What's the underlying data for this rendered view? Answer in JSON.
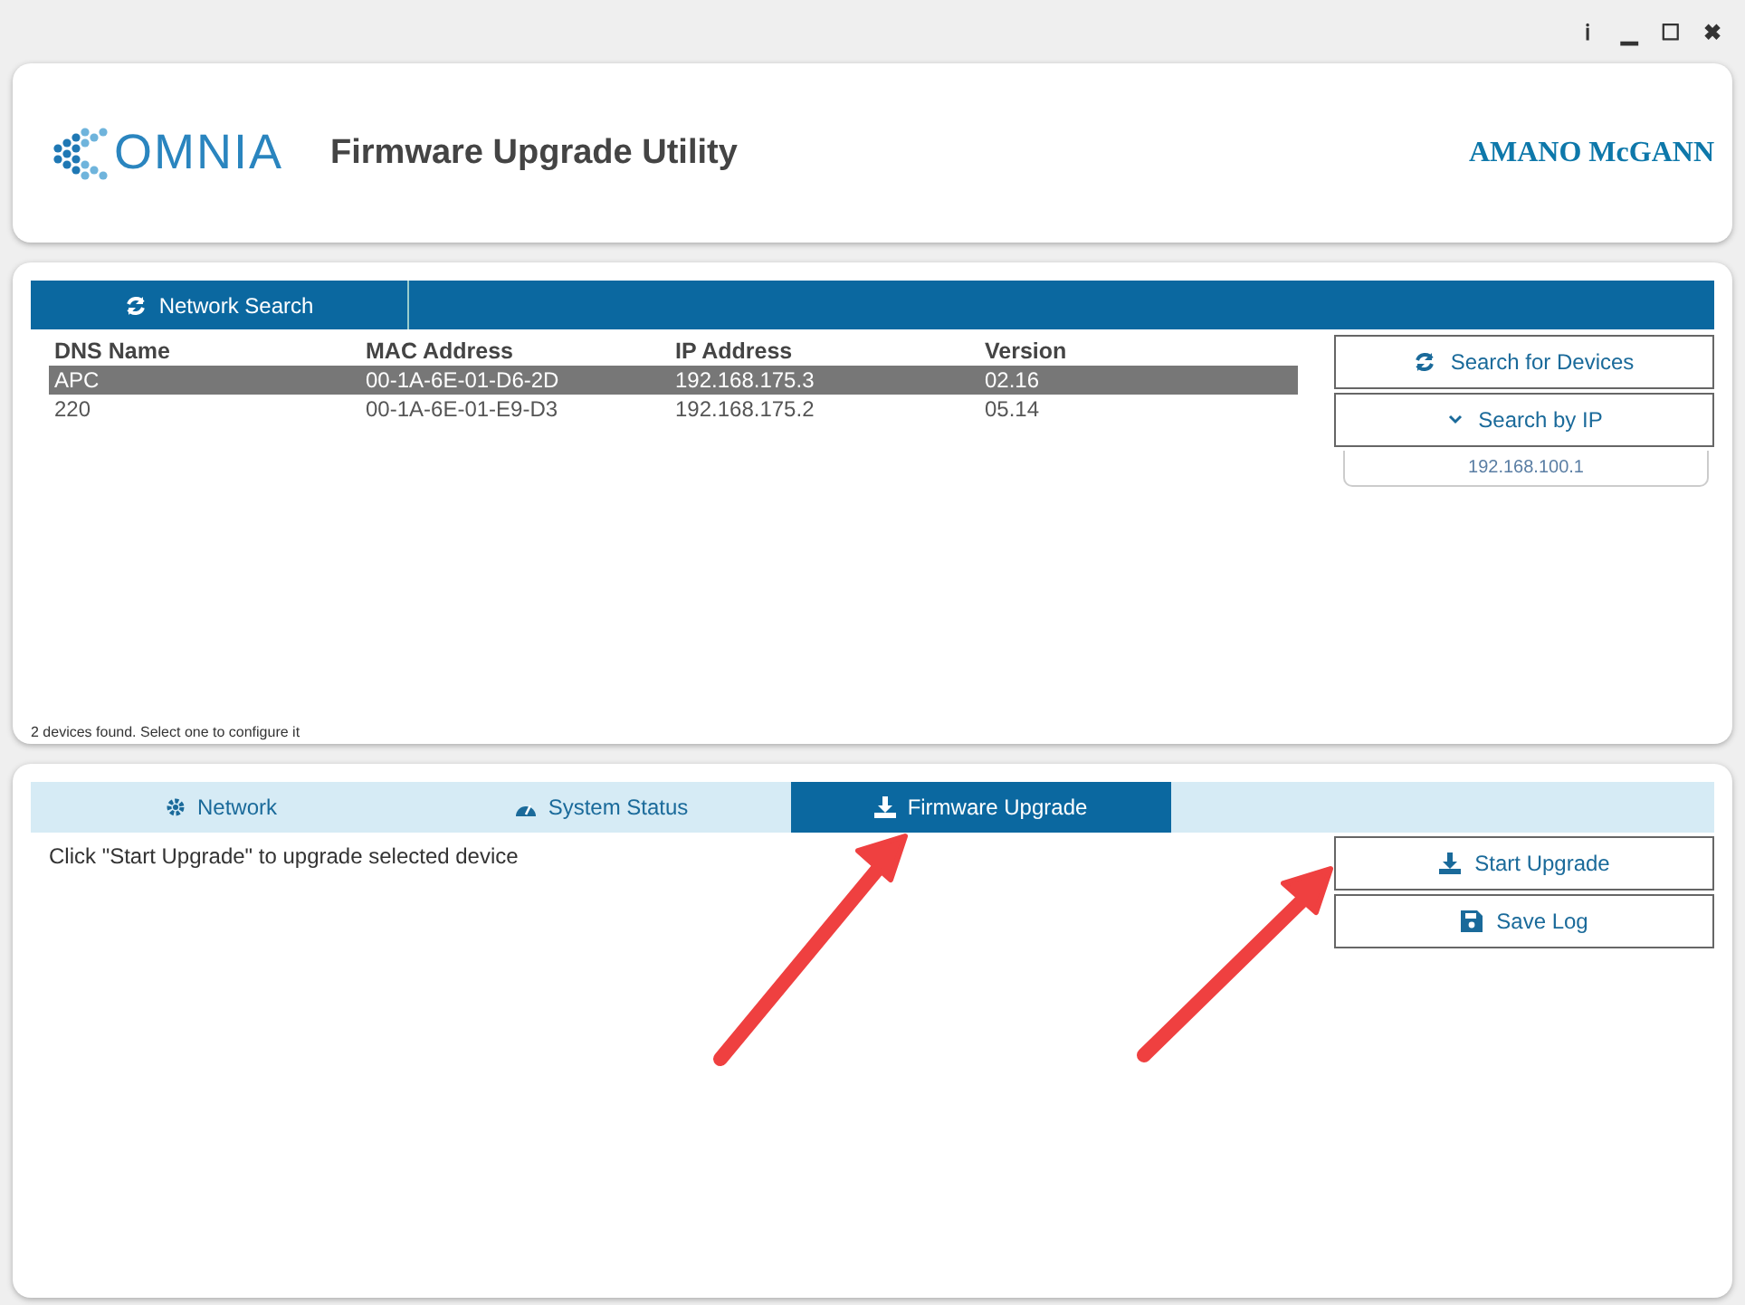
{
  "window_controls": {
    "info": "ℹ",
    "minimize": "▁",
    "maximize": "☐",
    "close": "✖"
  },
  "header": {
    "logo_text": "OMNIA",
    "title": "Firmware Upgrade Utility",
    "brand": "AMANO McGANN"
  },
  "network": {
    "tab": "Network Search",
    "columns": [
      "DNS Name",
      "MAC Address",
      "IP Address",
      "Version"
    ],
    "rows": [
      {
        "cells": [
          "APC",
          "00-1A-6E-01-D6-2D",
          "192.168.175.3",
          "02.16"
        ],
        "selected": true
      },
      {
        "cells": [
          "220",
          "00-1A-6E-01-E9-D3",
          "192.168.175.2",
          "05.14"
        ],
        "selected": false
      }
    ],
    "search_button": "Search for Devices",
    "search_ip_button": "Search by IP",
    "ip_value": "192.168.100.1",
    "status": "2 devices found. Select one to configure it"
  },
  "tabs": [
    {
      "label": "Network",
      "selected": false
    },
    {
      "label": "System Status",
      "selected": false
    },
    {
      "label": "Firmware Upgrade",
      "selected": true
    }
  ],
  "upgrade": {
    "message": "Click \"Start Upgrade\" to upgrade selected device",
    "start_button": "Start Upgrade",
    "save_button": "Save Log"
  },
  "annotations": [
    {
      "kind": "arrow"
    },
    {
      "kind": "arrow"
    }
  ]
}
